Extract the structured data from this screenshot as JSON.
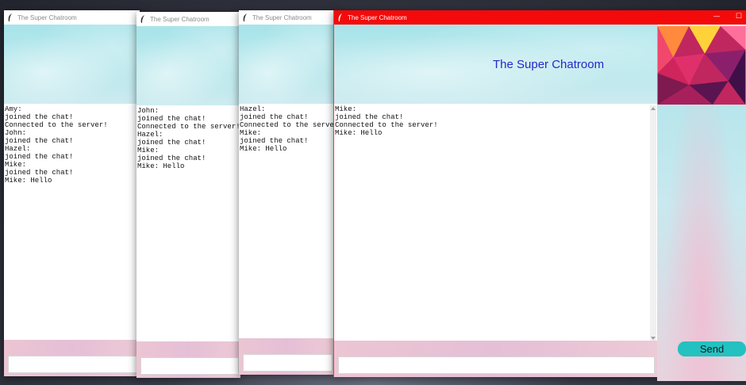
{
  "windows": [
    {
      "title": "The Super Chatroom",
      "messages": "Amy:\njoined the chat!\nConnected to the server!\nJohn:\njoined the chat!\nHazel:\njoined the chat!\nMike:\njoined the chat!\nMike: Hello"
    },
    {
      "title": "The Super Chatroom",
      "messages": "John:\njoined the chat!\nConnected to the server!\nHazel:\njoined the chat!\nMike:\njoined the chat!\nMike: Hello"
    },
    {
      "title": "The Super Chatroom",
      "messages": "Hazel:\njoined the chat!\nConnected to the server!\nMike:\njoined the chat!\nMike: Hello"
    },
    {
      "title": "The Super Chatroom",
      "messages": "Mike:\njoined the chat!\nConnected to the server!\nMike: Hello"
    }
  ],
  "main": {
    "banner_title": "The Super Chatroom",
    "send_label": "Send",
    "minimize_glyph": "—",
    "maximize_glyph": "☐"
  },
  "colors": {
    "active_titlebar": "#f40a0a",
    "send_button": "#24c1c1",
    "banner_title": "#2727c8"
  }
}
